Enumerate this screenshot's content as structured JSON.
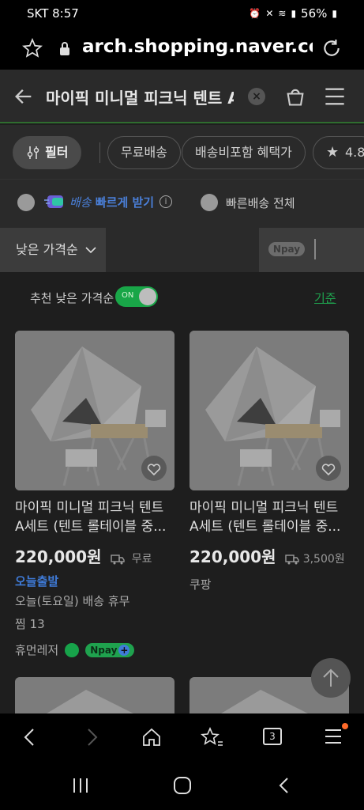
{
  "status": {
    "carrier_time": "SKT 8:57",
    "battery": "56%"
  },
  "browser": {
    "url": "arch.shopping.naver.com"
  },
  "header": {
    "query": "마이픽 미니멀 피크닉 텐트 A"
  },
  "chips": [
    "필터",
    "무료배송",
    "배송비포함 혜택가",
    "4.8"
  ],
  "options": {
    "fast_label": "배송",
    "fast_label2": "빠르게 받기",
    "all_fast": "빠른배송 전체",
    "info": "i"
  },
  "sort": {
    "label": "낮은 가격순",
    "npay": "pay"
  },
  "recommend": {
    "label": "추천 낮은 가격순",
    "toggle": "ON",
    "criteria": "기준"
  },
  "products": [
    {
      "title": "마이픽 미니멀 피크닉 텐트 A세트 (텐트 롤테이블 중...",
      "price": "220,000원",
      "shipping": "무료",
      "badge": "오늘출발",
      "note": "오늘(토요일) 배송 휴무",
      "likes": "찜 13",
      "seller": "휴먼레저",
      "npay": "pay"
    },
    {
      "title": "마이픽 미니멀 피크닉 텐트 A세트 (텐트 롤테이블 중...",
      "price": "220,000원",
      "shipping": "3,500원",
      "seller": "쿠팡"
    }
  ],
  "bottom_nav": {
    "tabs": "3"
  }
}
